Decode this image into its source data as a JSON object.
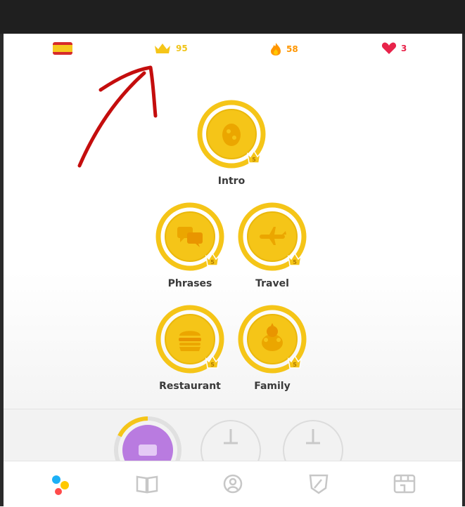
{
  "status_bar": {
    "flag": "spanish-flag-icon",
    "crowns": "95",
    "streak": "58",
    "hearts": "3"
  },
  "skills": [
    {
      "name": "Intro",
      "level": "5"
    },
    {
      "name": "Phrases",
      "level": "5"
    },
    {
      "name": "Travel",
      "level": "5"
    },
    {
      "name": "Restaurant",
      "level": "5"
    },
    {
      "name": "Family",
      "level": "5"
    }
  ],
  "tabs": [
    "learn-tab",
    "stories-tab",
    "profile-tab",
    "leagues-tab",
    "shop-tab"
  ],
  "colors": {
    "gold": "#f5c518",
    "gold_dark": "#e3aa00",
    "streak": "#ff9600",
    "heart": "#e8234a",
    "arrow": "#c40d0d"
  }
}
